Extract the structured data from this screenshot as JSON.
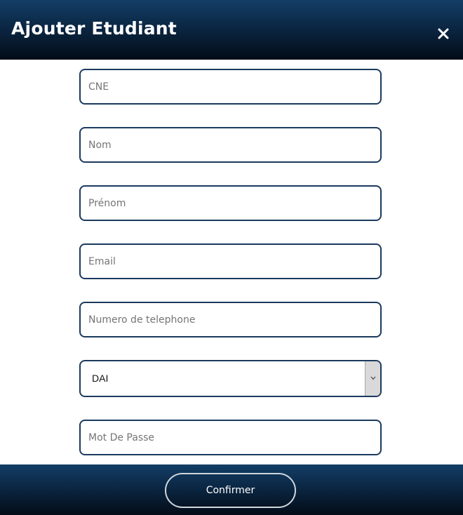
{
  "dialog": {
    "title": "Ajouter Etudiant",
    "close_icon": "close-icon"
  },
  "form": {
    "cne_placeholder": "CNE",
    "nom_placeholder": "Nom",
    "prenom_placeholder": "Prénom",
    "email_placeholder": "Email",
    "telephone_placeholder": "Numero de telephone",
    "filiere_selected": "DAI",
    "password_placeholder": "Mot De Passe"
  },
  "footer": {
    "confirm_label": "Confirmer"
  },
  "colors": {
    "header_dark": "#030c17",
    "header_light": "#133e66",
    "field_border": "#1b3a5e"
  }
}
